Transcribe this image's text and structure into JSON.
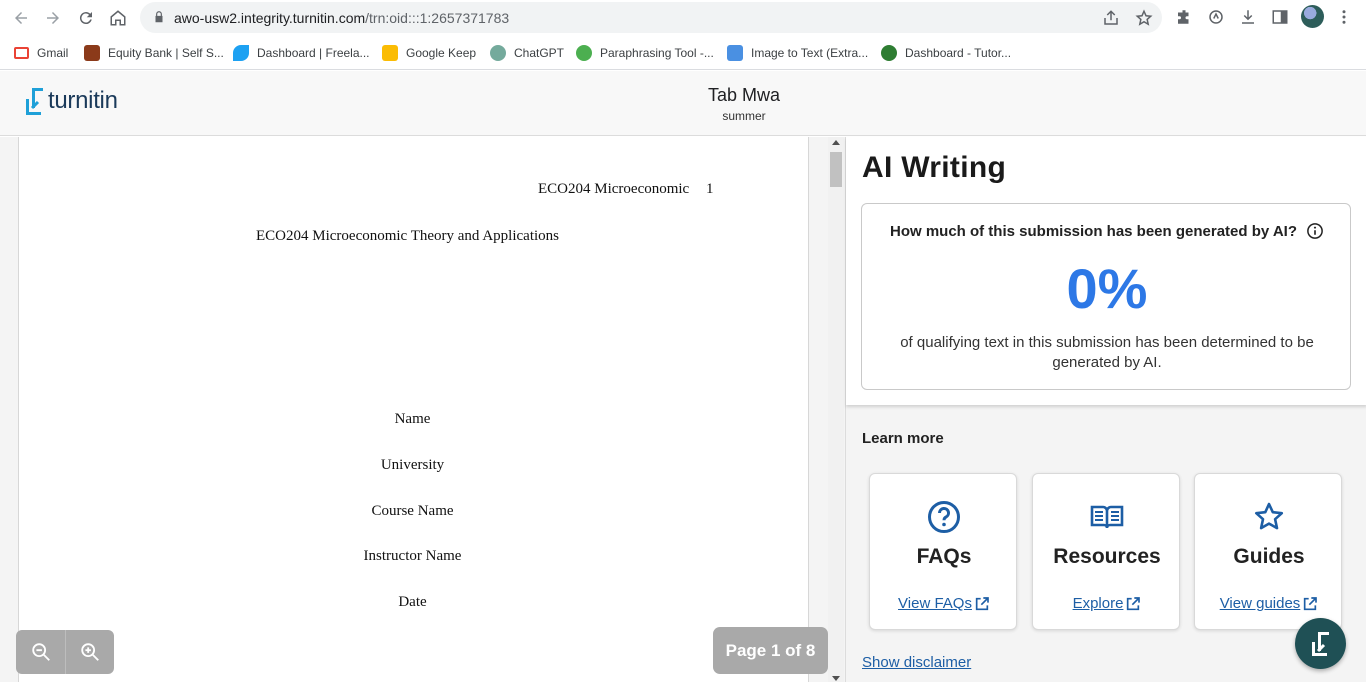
{
  "browser": {
    "url_host": "awo-usw2.integrity.turnitin.com",
    "url_path": "/trn:oid:::1:2657371783",
    "bookmarks": [
      {
        "label": "Gmail",
        "color": "#ea4335"
      },
      {
        "label": "Equity Bank | Self S...",
        "color": "#8b3a1a"
      },
      {
        "label": "Dashboard | Freela...",
        "color": "#1da1f2"
      },
      {
        "label": "Google Keep",
        "color": "#fbbc04"
      },
      {
        "label": "ChatGPT",
        "color": "#74aa9c"
      },
      {
        "label": "Paraphrasing Tool -...",
        "color": "#4caf50"
      },
      {
        "label": "Image to Text (Extra...",
        "color": "#4a90e2"
      },
      {
        "label": "Dashboard - Tutor...",
        "color": "#2e7d32"
      }
    ]
  },
  "header": {
    "logo_text": "turnitin",
    "title": "Tab Mwa",
    "subtitle": "summer"
  },
  "document": {
    "running_head": "ECO204 Microeconomic",
    "page_number": "1",
    "doc_title": "ECO204 Microeconomic Theory and Applications",
    "name": "Name",
    "university": "University",
    "course": "Course Name",
    "instructor": "Instructor Name",
    "date": "Date",
    "page_indicator": "Page 1 of 8"
  },
  "ai_panel": {
    "title": "AI Writing",
    "question": "How much of this submission has been generated by AI?",
    "percent": "0%",
    "description": "of qualifying text in this submission has been determined to be generated by AI.",
    "learn_more": "Learn more",
    "cards": [
      {
        "title": "FAQs",
        "link": "View FAQs",
        "icon": "question-circle-icon"
      },
      {
        "title": "Resources",
        "link": "Explore",
        "icon": "open-book-icon"
      },
      {
        "title": "Guides",
        "link": "View guides",
        "icon": "star-icon"
      }
    ],
    "disclaimer": "Show disclaimer"
  },
  "colors": {
    "accent": "#2d78e6",
    "link": "#1d5ea5",
    "brand": "#1b3a5a",
    "fab": "#1f5055"
  }
}
